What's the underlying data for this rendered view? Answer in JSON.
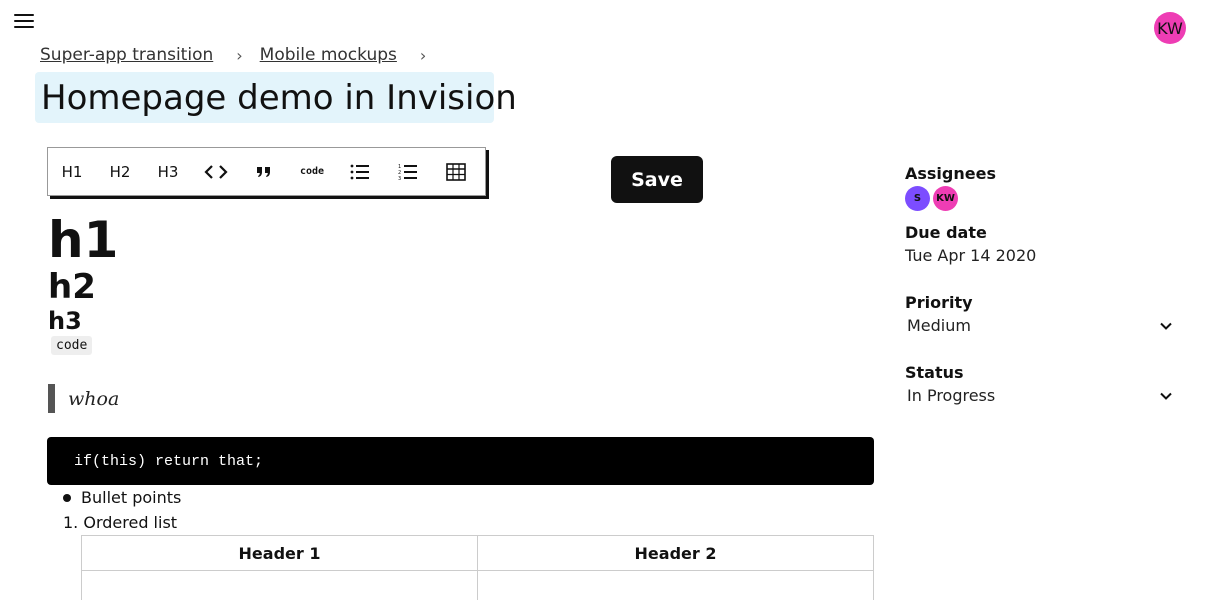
{
  "header": {
    "avatar_initials": "KW",
    "avatar_color": "#ee3db4"
  },
  "breadcrumb": {
    "items": [
      "Super-app transition",
      "Mobile mockups"
    ],
    "separator": "›"
  },
  "page": {
    "title": "Homepage demo in Invision",
    "title_bg": "#e3f4fb"
  },
  "toolbar": {
    "buttons": [
      "H1",
      "H2",
      "H3",
      "code-inline-icon",
      "quote-icon",
      "code",
      "bullet-list-icon",
      "ordered-list-icon",
      "table-icon"
    ],
    "labels": {
      "h1": "H1",
      "h2": "H2",
      "h3": "H3",
      "code": "code"
    }
  },
  "save_label": "Save",
  "editor": {
    "h1": "h1",
    "h2": "h2",
    "h3": "h3",
    "inline_code": "code",
    "blockquote": "whoa",
    "code_block": "if(this) return that;",
    "bullet": "Bullet points",
    "ordered": "1. Ordered list",
    "table_headers": [
      "Header 1",
      "Header 2"
    ]
  },
  "sidebar": {
    "assignees_label": "Assignees",
    "assignees": [
      {
        "initials": "S",
        "color": "#7c4dff"
      },
      {
        "initials": "KW",
        "color": "#ee3db4"
      }
    ],
    "due_label": "Due date",
    "due_value": "Tue Apr 14 2020",
    "priority_label": "Priority",
    "priority_value": "Medium",
    "status_label": "Status",
    "status_value": "In Progress"
  }
}
